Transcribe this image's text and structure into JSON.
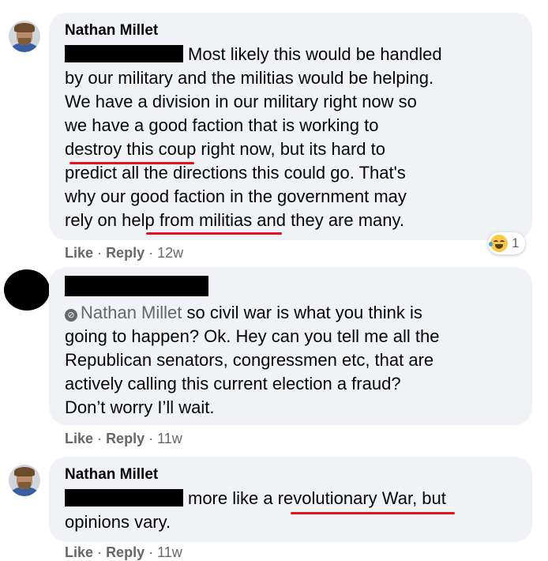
{
  "comments": [
    {
      "author": "Nathan Millet",
      "lines": [
        "Most likely this would be handled",
        "by our military and the militias would be helping.",
        "We have a division in our military right now so",
        "we have a good faction that is working to",
        "destroy this coup right now, but its hard to",
        "predict all the directions this could go. That's",
        "why our good faction in the government may",
        "rely on help from militias and they are many."
      ],
      "reaction_count": "1",
      "like": "Like",
      "reply": "Reply",
      "time": "12w"
    },
    {
      "mention": "Nathan Millet",
      "lines": [
        "so civil war is what you think is",
        "going to happen? Ok. Hey can you tell me all the",
        "Republican senators, congressmen etc, that are",
        "actively calling this current election a fraud?",
        "Don’t worry I’ll wait."
      ],
      "like": "Like",
      "reply": "Reply",
      "time": "11w"
    },
    {
      "author": "Nathan Millet",
      "lines": [
        "more like a revolutionary War, but",
        "opinions vary."
      ],
      "like": "Like",
      "reply": "Reply",
      "time": "11w"
    }
  ],
  "separator": "·",
  "colors": {
    "bubble": "#f0f2f5",
    "meta_text": "#65676b",
    "annotation_underline": "#e0141e",
    "redaction": "#000000"
  },
  "icons": [
    "reaction-haha-icon",
    "mention-icon"
  ]
}
